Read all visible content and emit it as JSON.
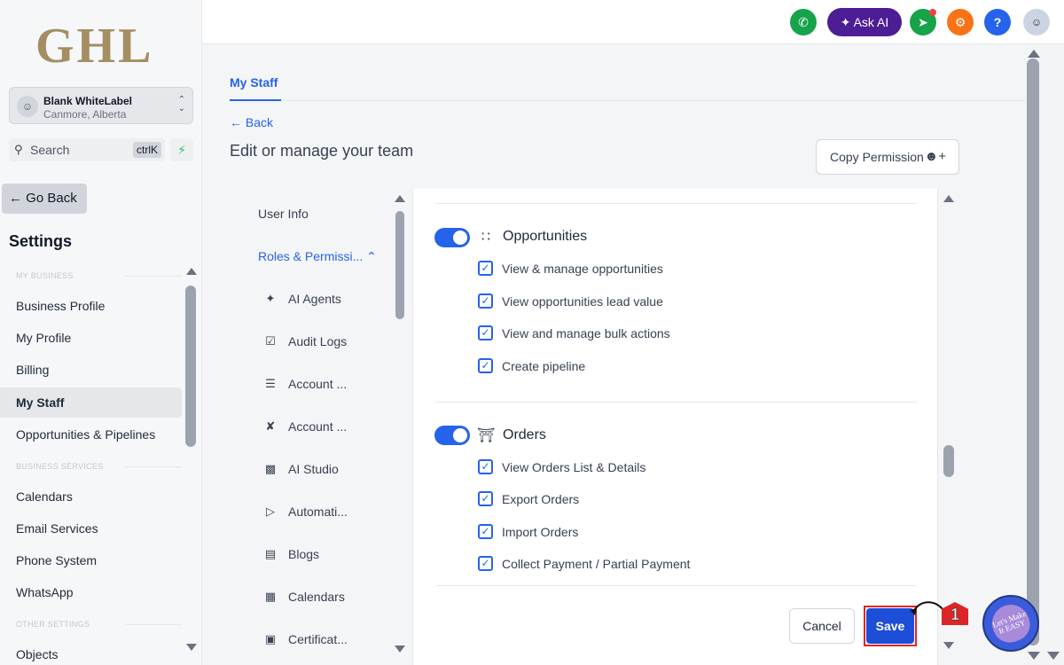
{
  "brand": {
    "logo": "GHL"
  },
  "account": {
    "name": "Blank WhiteLabel",
    "location": "Canmore, Alberta"
  },
  "search": {
    "placeholder": "Search",
    "shortcut": "ctrlK"
  },
  "sidebar": {
    "go_back": "Go Back",
    "title": "Settings",
    "sections": [
      {
        "label": "MY BUSINESS"
      },
      {
        "label": "BUSINESS SERVICES"
      },
      {
        "label": "OTHER SETTINGS"
      }
    ],
    "items": [
      {
        "label": "Business Profile"
      },
      {
        "label": "My Profile"
      },
      {
        "label": "Billing"
      },
      {
        "label": "My Staff",
        "active": true
      },
      {
        "label": "Opportunities & Pipelines"
      },
      {
        "label": "Calendars"
      },
      {
        "label": "Email Services"
      },
      {
        "label": "Phone System"
      },
      {
        "label": "WhatsApp"
      },
      {
        "label": "Objects"
      }
    ]
  },
  "topbar": {
    "ask_ai": "Ask AI",
    "help": "?"
  },
  "main": {
    "tab": "My Staff",
    "back": "Back",
    "title": "Edit or manage your team",
    "copy_permission": "Copy Permission"
  },
  "subnav": {
    "user_info": "User Info",
    "roles": "Roles & Permissi...",
    "children": [
      {
        "label": "AI Agents",
        "icon": "sparkle-icon"
      },
      {
        "label": "Audit Logs",
        "icon": "clipboard-check-icon"
      },
      {
        "label": "Account ...",
        "icon": "toggle-stack-icon"
      },
      {
        "label": "Account ...",
        "icon": "tools-icon"
      },
      {
        "label": "AI Studio",
        "icon": "ai-studio-icon"
      },
      {
        "label": "Automati...",
        "icon": "play-circle-icon"
      },
      {
        "label": "Blogs",
        "icon": "document-icon"
      },
      {
        "label": "Calendars",
        "icon": "calendar-icon"
      },
      {
        "label": "Certificat...",
        "icon": "certificate-icon"
      }
    ]
  },
  "permissions": {
    "groups": [
      {
        "title": "Opportunities",
        "icon": "opportunities-icon",
        "enabled": true,
        "items": [
          "View & manage opportunities",
          "View opportunities lead value",
          "View and manage bulk actions",
          "Create pipeline"
        ]
      },
      {
        "title": "Orders",
        "icon": "cart-icon",
        "enabled": true,
        "items": [
          "View Orders List & Details",
          "Export Orders",
          "Import Orders",
          "Collect Payment / Partial Payment"
        ]
      }
    ]
  },
  "actions": {
    "cancel": "Cancel",
    "save": "Save"
  },
  "annotation": {
    "step": "1"
  },
  "watermark": {
    "text": "Let's Make It EASY"
  },
  "colors": {
    "accent": "#2563eb",
    "save": "#1d4ed8",
    "highlight": "#dc2626",
    "logo": "#a48e62"
  }
}
